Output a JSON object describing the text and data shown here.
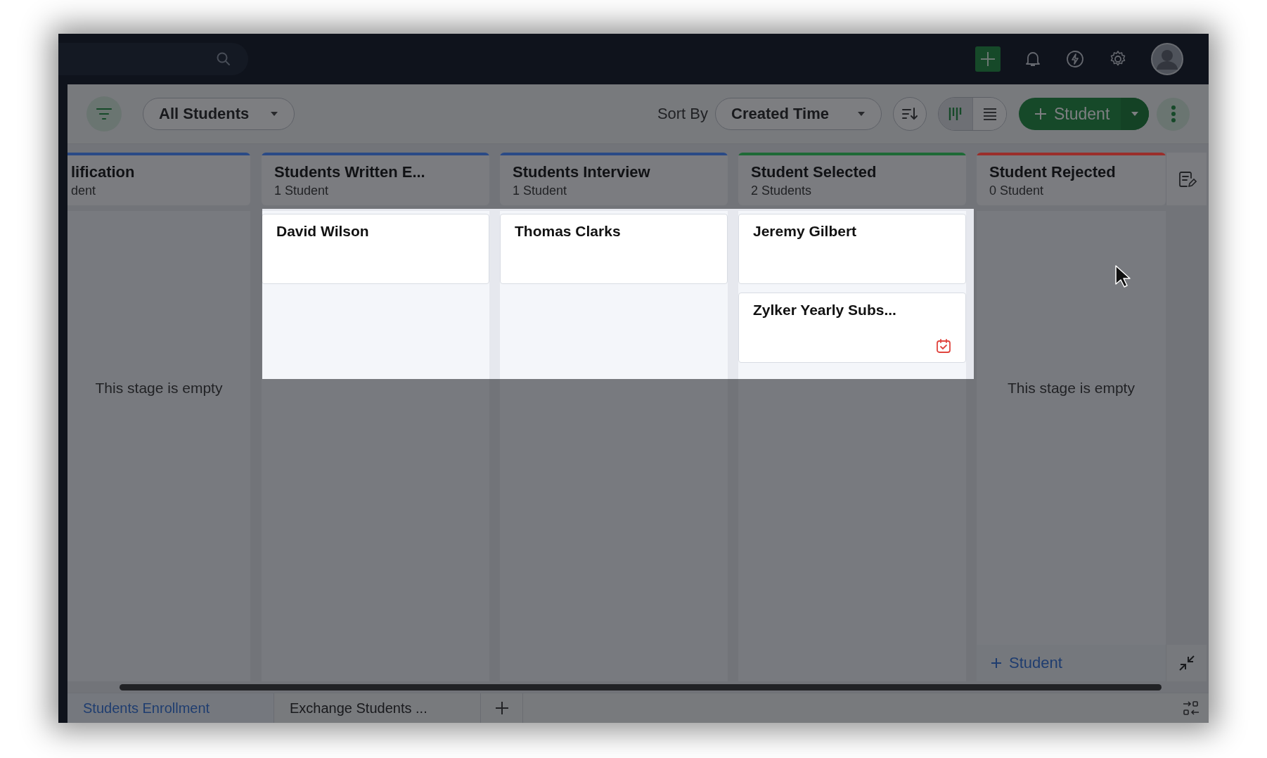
{
  "toolbar": {
    "view_filter": "All Students",
    "sort_label": "Sort By",
    "sort_value": "Created Time",
    "views": [
      {
        "kind": "kanban",
        "selected": true
      },
      {
        "kind": "list",
        "selected": false
      }
    ],
    "add_button": "Student"
  },
  "stages": [
    {
      "title": "lification",
      "count": "dent",
      "color": "#2a4a86",
      "empty_text": "This stage is empty"
    },
    {
      "title": "Students Written E...",
      "count": "1 Student",
      "color": "#2a4a86",
      "cards": [
        {
          "title": "David Wilson",
          "event": false
        }
      ]
    },
    {
      "title": "Students Interview",
      "count": "1 Student",
      "color": "#2a4a86",
      "cards": [
        {
          "title": "Thomas Clarks",
          "event": false
        }
      ]
    },
    {
      "title": "Student Selected",
      "count": "2 Students",
      "color": "#1e6a36",
      "cards": [
        {
          "title": "Jeremy Gilbert",
          "event": false
        },
        {
          "title": "Zylker Yearly Subs...",
          "event": true
        }
      ]
    },
    {
      "title": "Student Rejected",
      "count": "0 Student",
      "color": "#9a2e2a",
      "empty_text": "This stage is empty",
      "add_label": "Student"
    }
  ],
  "tabs": [
    {
      "label": "Students Enrollment",
      "selected": true
    },
    {
      "label": "Exchange Students ...",
      "selected": false
    }
  ]
}
